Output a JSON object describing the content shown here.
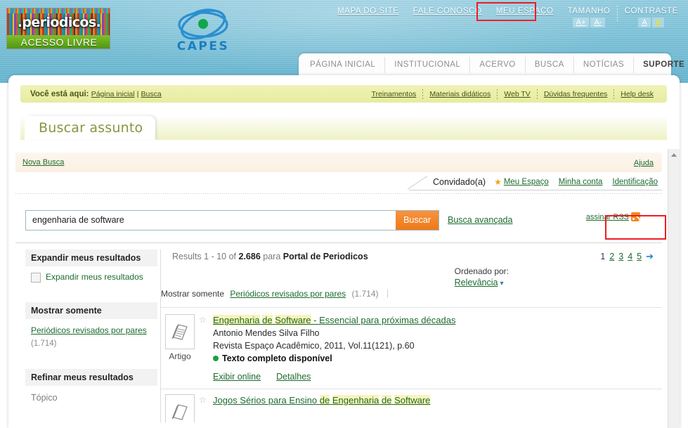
{
  "header": {
    "logo_periodicos": {
      "word": ".periodicos.",
      "sub": "ACESSO LIVRE"
    },
    "logo_capes": {
      "text": "CAPES"
    },
    "top_links": [
      {
        "label": "MAPA DO SITE"
      },
      {
        "label": "FALE CONOSCO"
      },
      {
        "label": "MEU ESPAÇO"
      }
    ],
    "tamanho": {
      "label": "TAMANHO",
      "increase": "A+",
      "decrease": "A-"
    },
    "contraste": {
      "label": "CONTRASTE",
      "normal": "A",
      "high": "A"
    },
    "highlight_color": "#ee1c24"
  },
  "nav_tabs": [
    {
      "label": "PÁGINA INICIAL",
      "active": false
    },
    {
      "label": "INSTITUCIONAL",
      "active": false
    },
    {
      "label": "ACERVO",
      "active": false
    },
    {
      "label": "BUSCA",
      "active": false
    },
    {
      "label": "NOTÍCIAS",
      "active": false
    },
    {
      "label": "SUPORTE",
      "active": true
    }
  ],
  "breadcrumb": {
    "prefix": "Você está aqui:",
    "items": [
      "Página inicial",
      "Busca"
    ],
    "separator": "|",
    "right_links": [
      "Treinamentos",
      "Materiais didáticos",
      "Web TV",
      "Dúvidas frequentes",
      "Help desk"
    ]
  },
  "page_tab": {
    "title": "Buscar assunto"
  },
  "toolbar": {
    "nova_busca": "Nova Busca",
    "ajuda": "Ajuda"
  },
  "user_bar": {
    "guest": "Convidado(a)",
    "star_icon": "star-icon",
    "links": [
      "Meu Espaço",
      "Minha conta",
      "Identificação"
    ]
  },
  "search": {
    "value": "engenharia de software",
    "placeholder": "",
    "button": "Buscar",
    "advanced_link": "Busca avançada",
    "rss_link": "assinar RSS",
    "rss_icon": "rss-icon",
    "accent_color": "#ee7a18"
  },
  "facets": [
    {
      "title": "Expandir meus resultados",
      "type": "checkbox",
      "checkbox_label": "Expandir meus resultados",
      "checked": false
    },
    {
      "title": "Mostrar somente",
      "type": "link",
      "link_label": "Periódicos revisados por pares",
      "count": "(1.714)"
    },
    {
      "title": "Refinar meus resultados",
      "type": "sub",
      "sub_label": "Tópico"
    }
  ],
  "results_header": {
    "prefix": "Results 1 - 10 of",
    "total": "2.686",
    "middle": "para",
    "scope": "Portal de Periodicos",
    "sort_label": "Ordenado por:",
    "sort_value": "Relevância",
    "sort_caret": "chevron-down-icon",
    "show_only_label": "Mostrar somente",
    "show_only_link": "Periódicos revisados por pares",
    "show_only_count": "(1.714)"
  },
  "pagination": {
    "pages": [
      "1",
      "2",
      "3",
      "4",
      "5"
    ],
    "current": "1",
    "next_icon": "arrow-right-icon"
  },
  "results": [
    {
      "type_label": "Artigo",
      "type_icon": "article-icon",
      "star_icon": "star-outline-icon",
      "title_parts": [
        {
          "text": "Engenharia",
          "highlight": true
        },
        {
          "text": " ",
          "highlight": false
        },
        {
          "text": "de",
          "highlight": true
        },
        {
          "text": " ",
          "highlight": false
        },
        {
          "text": "Software",
          "highlight": true
        },
        {
          "text": " - Essencial para próximas décadas",
          "highlight": false
        }
      ],
      "author": "Antonio Mendes Silva Filho",
      "source": "Revista Espaço Acadêmico, 2011, Vol.11(121), p.60",
      "availability": "Texto completo disponível",
      "availability_color": "#19a33a",
      "actions": [
        "Exibir online",
        "Detalhes"
      ]
    },
    {
      "type_label": "",
      "type_icon": "article-icon",
      "star_icon": "star-outline-icon",
      "title_parts": [
        {
          "text": "Jogos Sérios para Ensino ",
          "highlight": false
        },
        {
          "text": "de",
          "highlight": true
        },
        {
          "text": " ",
          "highlight": false
        },
        {
          "text": "Engenharia",
          "highlight": true
        },
        {
          "text": " ",
          "highlight": false
        },
        {
          "text": "de",
          "highlight": true
        },
        {
          "text": " ",
          "highlight": false
        },
        {
          "text": "Software",
          "highlight": true
        }
      ],
      "author": "",
      "source": "",
      "availability": "",
      "actions": []
    }
  ],
  "scrollbar": {
    "up_icon": "caret-up-icon"
  }
}
